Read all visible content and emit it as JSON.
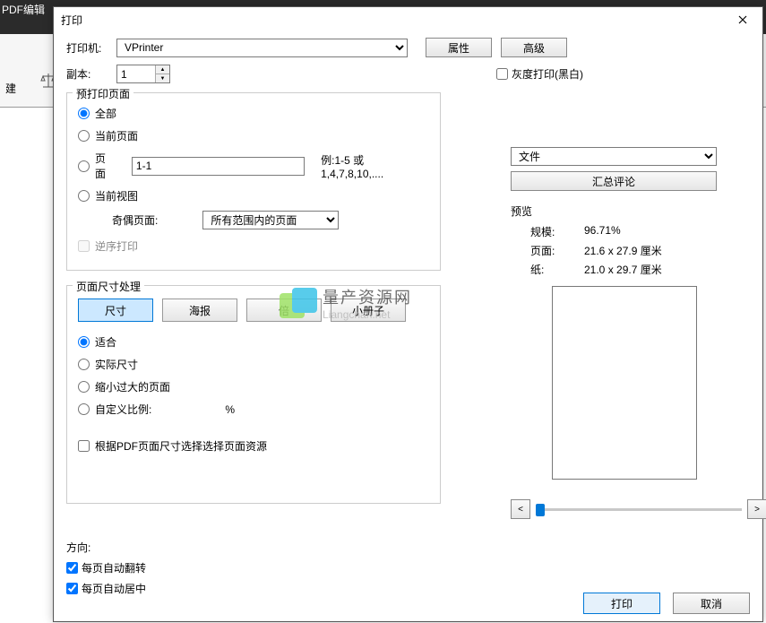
{
  "app": {
    "tab_label": "PDF编辑",
    "toolbar_label": "建"
  },
  "dialog": {
    "title": "打印",
    "printer_label": "打印机:",
    "printer_value": "VPrinter",
    "properties_btn": "属性",
    "advanced_btn": "高级",
    "copies_label": "副本:",
    "copies_value": "1",
    "grayscale_label": "灰度打印(黑白)"
  },
  "pages": {
    "legend": "预打印页面",
    "all": "全部",
    "current": "当前页面",
    "range": "页面",
    "range_value": "1-1",
    "example": "例:1-5 或 1,4,7,8,10,....",
    "view": "当前视图",
    "oddeven_label": "奇偶页面:",
    "oddeven_value": "所有范围内的页面",
    "reverse": "逆序打印"
  },
  "sizing": {
    "legend": "页面尺寸处理",
    "tabs": {
      "size": "尺寸",
      "poster": "海报",
      "multi": "倍",
      "booklet": "小册子"
    },
    "fit": "适合",
    "actual": "实际尺寸",
    "shrink": "缩小过大的页面",
    "custom": "自定义比例:",
    "custom_unit": "%",
    "paper_source": "根据PDF页面尺寸选择选择页面资源"
  },
  "right": {
    "file_select": "文件",
    "summarize_btn": "汇总评论",
    "preview_label": "预览",
    "scale_label": "规模:",
    "scale_value": "96.71%",
    "page_label": "页面:",
    "page_value": "21.6 x 27.9 厘米",
    "paper_label": "纸:",
    "paper_value": "21.0 x 29.7 厘米",
    "prev": "<",
    "next": ">"
  },
  "orientation": {
    "header": "方向:",
    "auto_rotate": "每页自动翻转",
    "auto_center": "每页自动居中"
  },
  "footer": {
    "print": "打印",
    "cancel": "取消"
  },
  "watermark": {
    "title": "量产资源网",
    "url": "Liangchan.net"
  }
}
